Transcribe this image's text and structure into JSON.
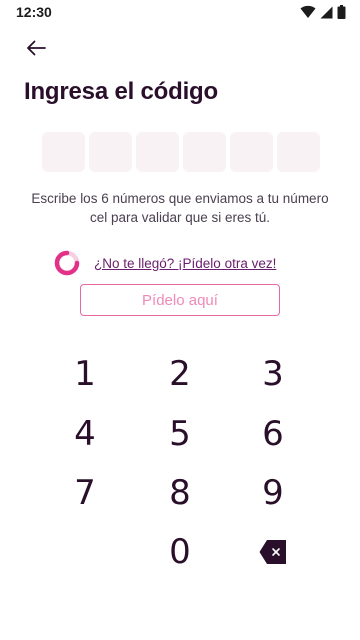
{
  "status_bar": {
    "time": "12:30",
    "icons": [
      "wifi-icon",
      "signal-icon",
      "battery-icon"
    ]
  },
  "header": {
    "back_icon": "arrow-left-icon",
    "title": "Ingresa el código"
  },
  "code_input": {
    "length": 6,
    "digits": [
      "",
      "",
      "",
      "",
      "",
      ""
    ]
  },
  "instructions": "Escribe los 6 números que enviamos a tu número cel para validar que si eres tú.",
  "resend": {
    "link_text": "¿No te llegó? ¡Pídelo otra vez!",
    "button_label": "Pídelo aquí"
  },
  "keypad": {
    "keys": [
      "1",
      "2",
      "3",
      "4",
      "5",
      "6",
      "7",
      "8",
      "9",
      "0"
    ],
    "backspace_icon": "backspace-icon"
  },
  "colors": {
    "title": "#2a0f2b",
    "code_box": "#f8f2f4",
    "link": "#6a1d6c",
    "accent_pink": "#e3318a",
    "button_border": "#e36aa6",
    "button_text": "#ef8ab8"
  }
}
